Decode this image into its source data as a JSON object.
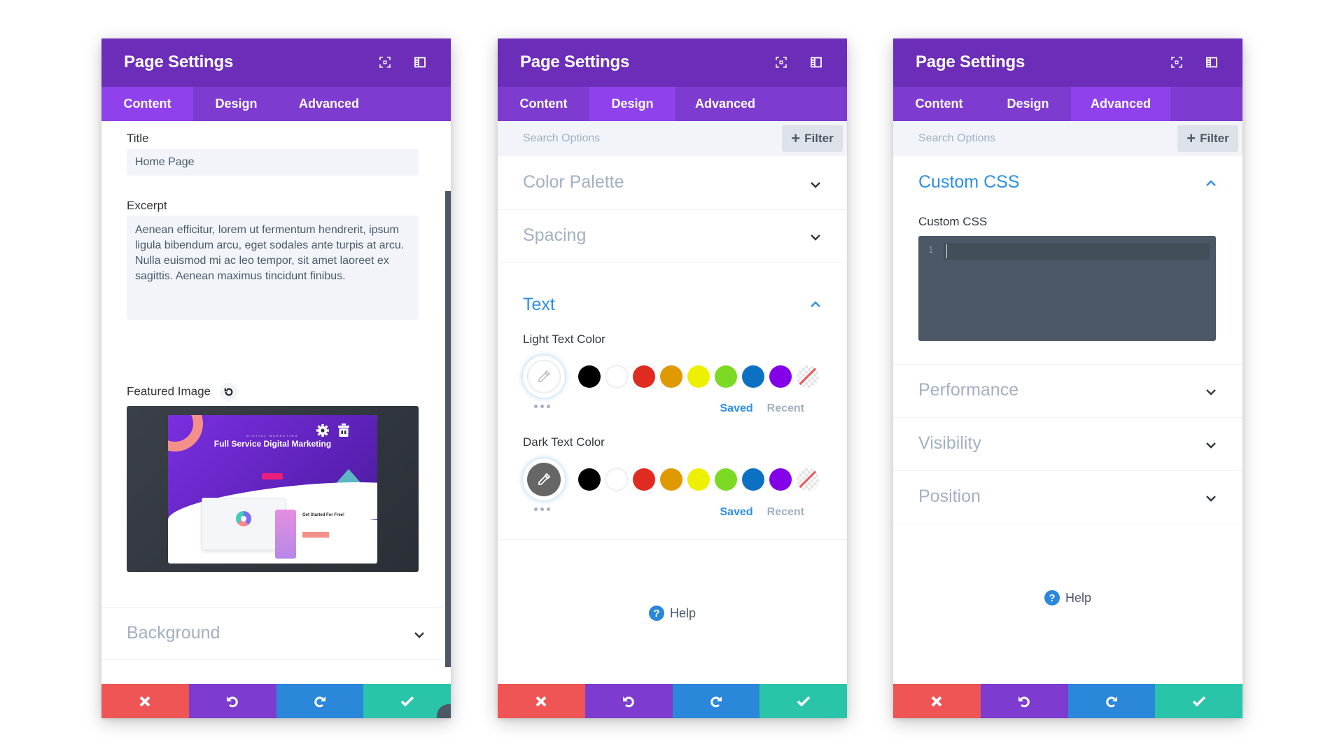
{
  "panels": [
    {
      "header": {
        "title": "Page Settings",
        "icons": [
          "expand-icon",
          "layout-icon"
        ]
      },
      "tabs": [
        {
          "label": "Content",
          "active": true
        },
        {
          "label": "Design",
          "active": false
        },
        {
          "label": "Advanced",
          "active": false
        }
      ],
      "fields": {
        "title_label": "Title",
        "title_value": "Home Page",
        "excerpt_label": "Excerpt",
        "excerpt_value": "Aenean efficitur, lorem ut fermentum hendrerit, ipsum ligula bibendum arcu, eget sodales ante turpis at arcu. Nulla euismod mi ac leo tempor, sit amet laoreet ex sagittis. Aenean maximus tincidunt finibus.",
        "featured_image_label": "Featured Image",
        "featured_image": {
          "kicker": "DIGITAL MARKETING",
          "headline": "Full Service Digital Marketing",
          "subhead": "Get Started For Free!"
        }
      },
      "toggles": [
        {
          "label": "Background",
          "open": false
        }
      ],
      "help_label": "Help"
    },
    {
      "header": {
        "title": "Page Settings"
      },
      "tabs": [
        {
          "label": "Content",
          "active": false
        },
        {
          "label": "Design",
          "active": true
        },
        {
          "label": "Advanced",
          "active": false
        }
      ],
      "search": {
        "placeholder": "Search Options",
        "filter_label": "Filter"
      },
      "toggles": [
        {
          "label": "Color Palette",
          "open": false
        },
        {
          "label": "Spacing",
          "open": false
        },
        {
          "label": "Text",
          "open": true
        }
      ],
      "text_section": {
        "light_label": "Light Text Color",
        "dark_label": "Dark Text Color",
        "saved_label": "Saved",
        "recent_label": "Recent",
        "swatches": [
          "#000000",
          "#ffffff",
          "#e02b20",
          "#e09900",
          "#edf000",
          "#7cda24",
          "#0c71c3",
          "#8300e9",
          "none"
        ]
      },
      "help_label": "Help"
    },
    {
      "header": {
        "title": "Page Settings"
      },
      "tabs": [
        {
          "label": "Content",
          "active": false
        },
        {
          "label": "Design",
          "active": false
        },
        {
          "label": "Advanced",
          "active": true
        }
      ],
      "search": {
        "placeholder": "Search Options",
        "filter_label": "Filter"
      },
      "toggles": [
        {
          "label": "Custom CSS",
          "open": true
        },
        {
          "label": "Performance",
          "open": false
        },
        {
          "label": "Visibility",
          "open": false
        },
        {
          "label": "Position",
          "open": false
        }
      ],
      "custom_css": {
        "label": "Custom CSS",
        "line_number": "1",
        "value": ""
      },
      "help_label": "Help"
    }
  ],
  "footer_buttons": [
    "cancel",
    "undo",
    "redo",
    "save"
  ],
  "colors": {
    "header": "#6c2eb9",
    "tabs": "#7e3bd0",
    "tab_active": "#8f42ec",
    "cancel": "#ef5555",
    "undo": "#7e3bd0",
    "redo": "#2b87da",
    "save": "#29c4a9",
    "accent_blue": "#2e8ee6"
  }
}
